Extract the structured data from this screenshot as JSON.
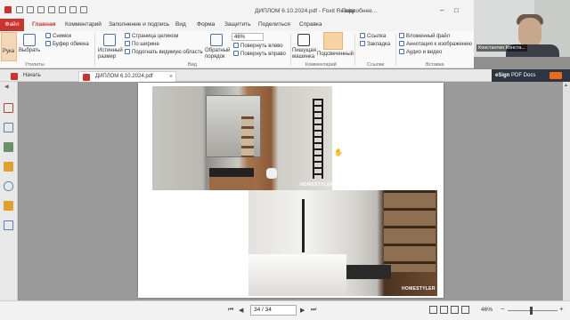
{
  "window": {
    "title": "ДИПЛОМ 6.10.2024.pdf - Foxit Reader",
    "search_hint": "Подробнее..."
  },
  "menu": {
    "file": "Файл",
    "tabs": [
      "Главная",
      "Комментарий",
      "Заполнение и подпись",
      "Вид",
      "Форма",
      "Защитить",
      "Поделиться",
      "Справка"
    ],
    "active_tab": "Главная"
  },
  "ribbon": {
    "tools": {
      "hand": "Рука",
      "select": "Выбрать",
      "snapshot": "Снимок",
      "clipboard": "Буфер обмена",
      "group": "Утилиты"
    },
    "view": {
      "actual_size": "Истинный размер",
      "fit_page": "Страница целиком",
      "fit_width": "По ширине",
      "fit_visible": "Подогнать видимую область",
      "reverse_order": "Обратный порядок",
      "zoom": "46%",
      "rotate_left": "Повернуть влево",
      "rotate_right": "Повернуть вправо",
      "group": "Вид"
    },
    "comment": {
      "typewriter": "Пишущая машинка",
      "highlight": "Подсвеченный",
      "group": "Комментарий"
    },
    "links": {
      "link": "Ссылка",
      "bookmark": "Закладка",
      "group": "Ссылки"
    },
    "insert": {
      "attachment": "Вложенный файл",
      "image_annotation": "Аннотация к изображению",
      "audio_video": "Аудио и видео",
      "group": "Вставка"
    }
  },
  "camera": {
    "name": "Константин Конста..."
  },
  "doc_tabs": [
    {
      "label": "Начать",
      "active": false
    },
    {
      "label": "ДИПЛОМ 6.10.2024.pdf",
      "active": true
    }
  ],
  "esign": {
    "brand": "eSign",
    "label": "PDF Docs"
  },
  "sidebar": {
    "icons": [
      "pages-icon",
      "copy-icon",
      "layers-icon",
      "comments-icon",
      "attachment-icon",
      "lock-icon",
      "signature-icon"
    ]
  },
  "document": {
    "watermark": "HOMESTYLER"
  },
  "status": {
    "page": "34 / 34",
    "zoom": "46%",
    "zoom_level": 0.46
  },
  "colors": {
    "accent": "#c9352e",
    "ribbon_bg": "#f9f9f9",
    "workspace_bg": "#9a9a9a"
  }
}
